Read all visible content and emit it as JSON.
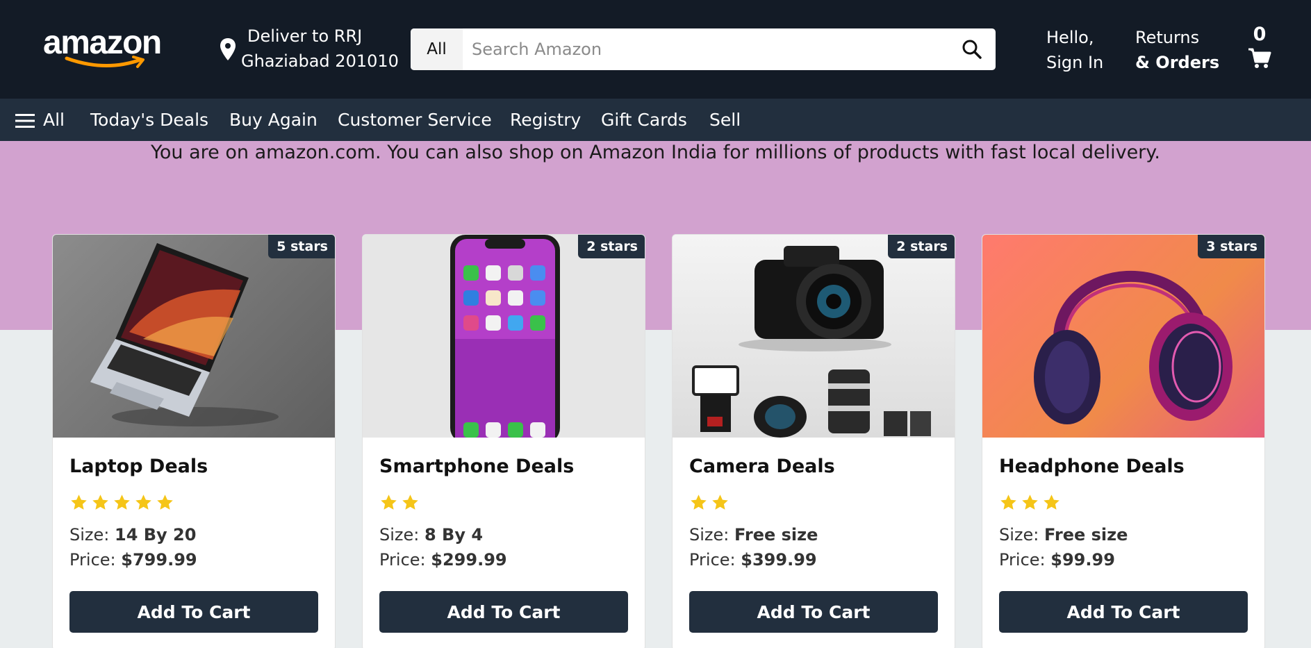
{
  "header": {
    "logo_text": "amazon",
    "deliver_line1": "Deliver to RRJ",
    "deliver_line2": "Ghaziabad 201010",
    "search_category": "All",
    "search_placeholder": "Search Amazon",
    "account_line1": "Hello,",
    "account_line2": "Sign In",
    "returns_line1": "Returns",
    "returns_line2": "& Orders",
    "cart_count": "0",
    "icons": [
      "location-pin-icon",
      "search-icon",
      "cart-icon"
    ]
  },
  "nav": {
    "menu_label": "All",
    "items": [
      "Today's Deals",
      "Buy Again",
      "Customer Service",
      "Registry",
      "Gift Cards",
      "Sell"
    ]
  },
  "notice": "You are on amazon.com. You can also shop on Amazon India for millions of products with fast local delivery.",
  "products": [
    {
      "title": "Laptop Deals",
      "badge": "5 stars",
      "rating": 5,
      "size_label": "Size:",
      "size": "14 By 20",
      "price_label": "Price:",
      "price": "$799.99",
      "button": "Add To Cart"
    },
    {
      "title": "Smartphone Deals",
      "badge": "2 stars",
      "rating": 2,
      "size_label": "Size:",
      "size": "8 By 4",
      "price_label": "Price:",
      "price": "$299.99",
      "button": "Add To Cart"
    },
    {
      "title": "Camera Deals",
      "badge": "2 stars",
      "rating": 2,
      "size_label": "Size:",
      "size": "Free size",
      "price_label": "Price:",
      "price": "$399.99",
      "button": "Add To Cart"
    },
    {
      "title": "Headphone Deals",
      "badge": "3 stars",
      "rating": 3,
      "size_label": "Size:",
      "size": "Free size",
      "price_label": "Price:",
      "price": "$99.99",
      "button": "Add To Cart"
    }
  ],
  "colors": {
    "header_bg": "#131b26",
    "nav_bg": "#222f3e",
    "hero_bg": "#d2a2cf",
    "page_bg": "#e9edee",
    "accent": "#ff9900",
    "star": "#f5c518"
  }
}
